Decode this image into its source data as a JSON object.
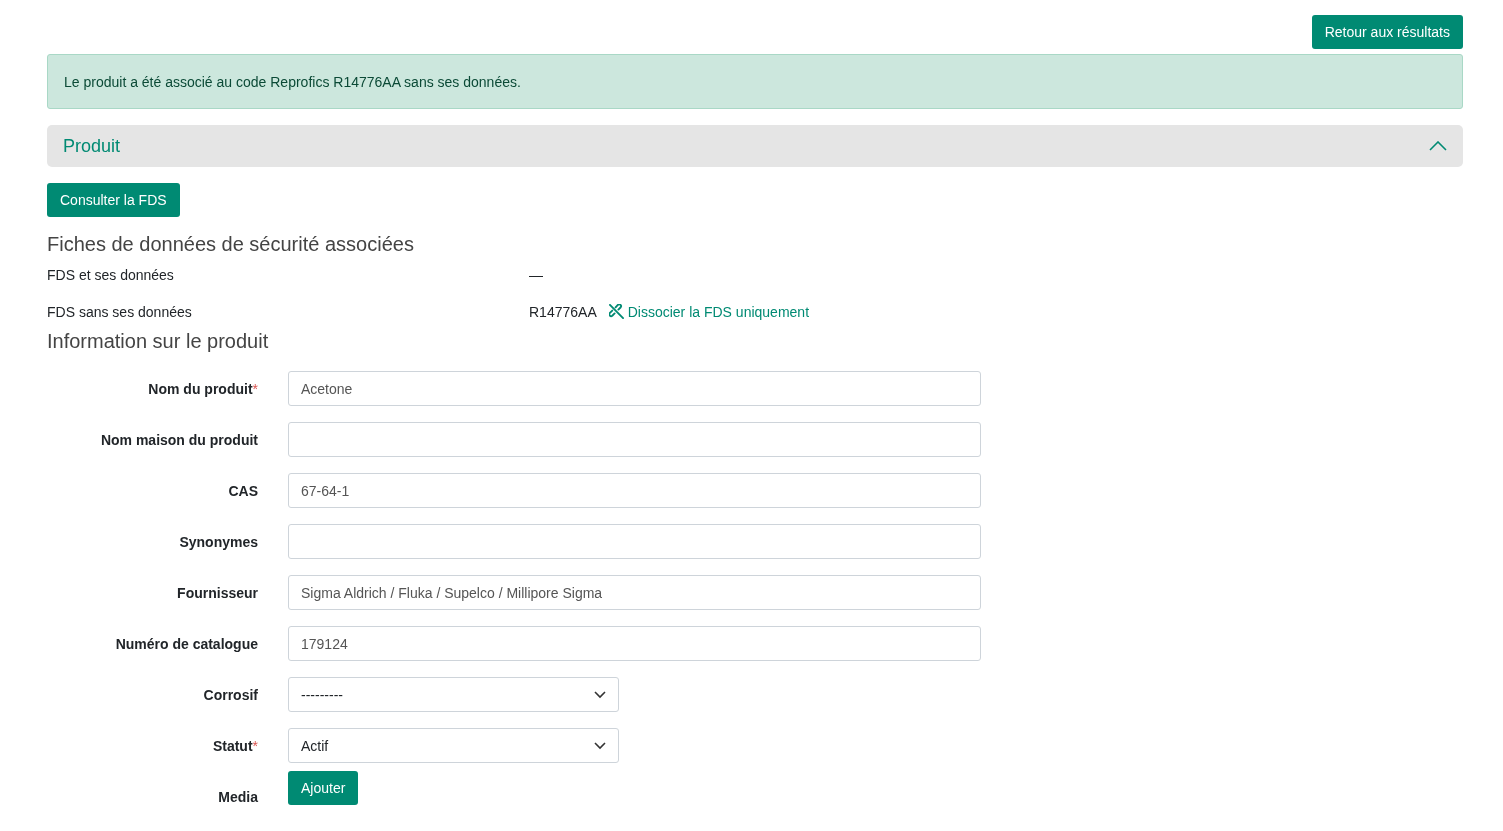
{
  "back_button": "Retour aux résultats",
  "alert": "Le produit a été associé au code Reprofics R14776AA sans ses données.",
  "panel": {
    "title": "Produit",
    "expanded": true
  },
  "sds_button": "Consulter la FDS",
  "sds_section": {
    "title": "Fiches de données de sécurité associées",
    "rows": [
      {
        "label": "FDS et ses données",
        "value": "—"
      },
      {
        "label": "FDS sans ses données",
        "value": "R14776AA",
        "link": "Dissocier la FDS uniquement"
      }
    ]
  },
  "info_section": {
    "title": "Information sur le produit",
    "fields": [
      {
        "kind": "text",
        "label": "Nom du produit",
        "required": true,
        "required_mark": "*",
        "value": "Acetone"
      },
      {
        "kind": "text",
        "label": "Nom maison du produit",
        "required": false
      },
      {
        "kind": "text",
        "label": "CAS",
        "required": false,
        "value": "67-64-1"
      },
      {
        "kind": "text",
        "label": "Synonymes",
        "required": false
      },
      {
        "kind": "text",
        "label": "Fournisseur",
        "required": false,
        "value": "Sigma Aldrich / Fluka / Supelco / Millipore Sigma"
      },
      {
        "kind": "text",
        "label": "Numéro de catalogue",
        "required": false,
        "value": "179124"
      },
      {
        "kind": "select",
        "label": "Corrosif",
        "required": false,
        "value": "---------"
      },
      {
        "kind": "select",
        "label": "Statut",
        "required": true,
        "required_mark": "*",
        "value": "Actif"
      },
      {
        "kind": "button",
        "label": "Media",
        "required": false,
        "value": "Ajouter"
      }
    ]
  }
}
